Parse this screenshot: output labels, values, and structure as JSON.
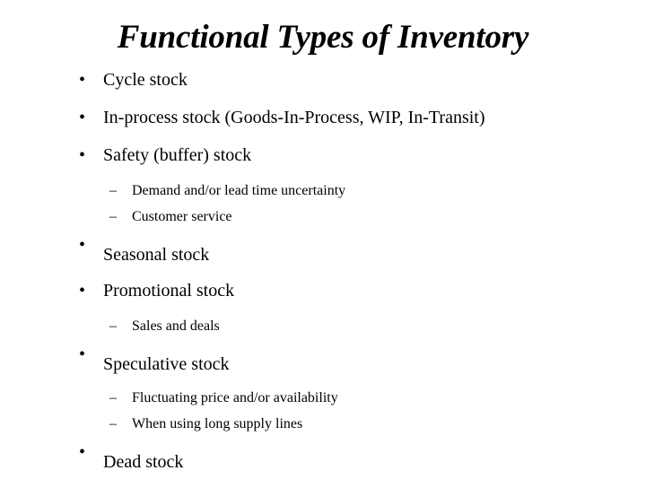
{
  "slide": {
    "title": "Functional Types of Inventory",
    "background_color": "#ffffff",
    "text_color": "#000000",
    "bullet_marker_level1": "•",
    "bullet_marker_level2": "–",
    "items": [
      {
        "level": 1,
        "text": "Cycle stock"
      },
      {
        "level": 1,
        "text": "In-process stock (Goods-In-Process, WIP, In-Transit)"
      },
      {
        "level": 1,
        "text": "Safety (buffer) stock"
      },
      {
        "level": 2,
        "text": "Demand and/or lead time uncertainty"
      },
      {
        "level": 2,
        "text": "Customer service"
      },
      {
        "level": 1,
        "text": "Seasonal stock"
      },
      {
        "level": 1,
        "text": "Promotional stock"
      },
      {
        "level": 2,
        "text": "Sales and deals"
      },
      {
        "level": 1,
        "text": "Speculative stock"
      },
      {
        "level": 2,
        "text": "Fluctuating price and/or availability"
      },
      {
        "level": 2,
        "text": "When using long supply lines"
      },
      {
        "level": 1,
        "text": "Dead stock"
      }
    ]
  }
}
